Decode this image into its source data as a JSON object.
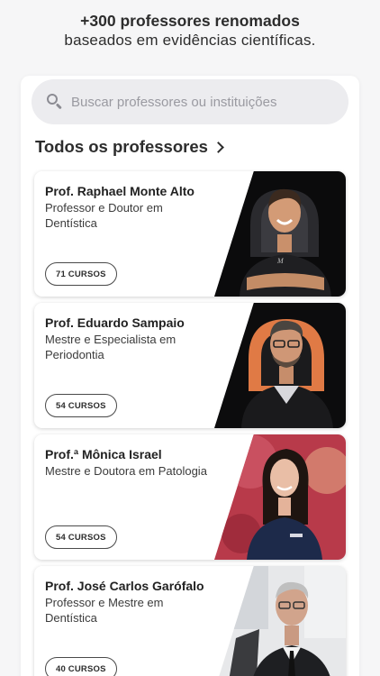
{
  "header": {
    "line1": "+300 professores renomados",
    "line2": "baseados em evidências científicas."
  },
  "search": {
    "placeholder": "Buscar professores ou instituições",
    "icon": "search-icon"
  },
  "section": {
    "title": "Todos os professores",
    "icon": "chevron-right-icon"
  },
  "professors": [
    {
      "name": "Prof. Raphael Monte Alto",
      "role": "Professor e Doutor em Dentística",
      "courses": "71 CURSOS"
    },
    {
      "name": "Prof. Eduardo Sampaio",
      "role": "Mestre e Especialista em Periodontia",
      "courses": "54 CURSOS"
    },
    {
      "name": "Prof.ª Mônica Israel",
      "role": "Mestre e Doutora em Patologia",
      "courses": "54 CURSOS"
    },
    {
      "name": "Prof. José Carlos Garófalo",
      "role": "Professor e Mestre em Dentística",
      "courses": "40 CURSOS"
    }
  ],
  "colors": {
    "background": "#f6f6f7",
    "card": "#ffffff",
    "search_bg": "#ececef",
    "text": "#2b2b2b"
  }
}
